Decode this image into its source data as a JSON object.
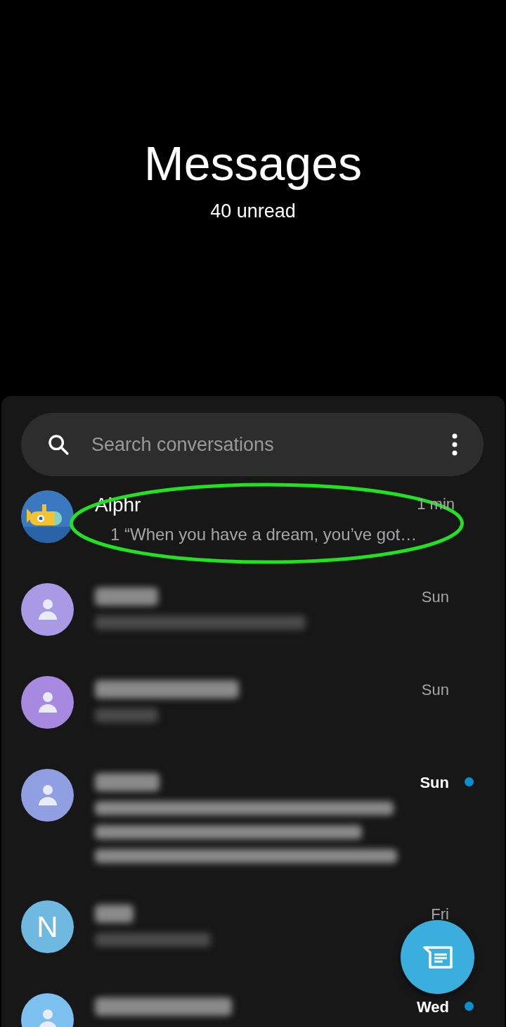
{
  "header": {
    "title": "Messages",
    "subtitle": "40 unread"
  },
  "search": {
    "placeholder": "Search conversations"
  },
  "conversations": [
    {
      "avatar": {
        "kind": "submarine",
        "color": "#3a78c0"
      },
      "name": "Alphr",
      "preview": [
        {
          "kind": "text",
          "text": "1 “When you have a dream, you’ve got…"
        }
      ],
      "time": "1 min",
      "unread": false,
      "highlighted": true
    },
    {
      "avatar": {
        "kind": "person",
        "color": "#a99ae6"
      },
      "name": {
        "kind": "redacted"
      },
      "preview": [
        {
          "kind": "redacted"
        }
      ],
      "time": "Sun",
      "unread": false,
      "highlighted": false
    },
    {
      "avatar": {
        "kind": "person",
        "color": "#a889e0"
      },
      "name": {
        "kind": "redacted"
      },
      "preview": [
        {
          "kind": "redacted"
        }
      ],
      "time": "Sun",
      "unread": false,
      "highlighted": false
    },
    {
      "avatar": {
        "kind": "person",
        "color": "#8f9fe2"
      },
      "name": {
        "kind": "redacted"
      },
      "preview": [
        {
          "kind": "redacted"
        },
        {
          "kind": "redacted"
        },
        {
          "kind": "redacted"
        }
      ],
      "time": "Sun",
      "unread": true,
      "highlighted": false
    },
    {
      "avatar": {
        "kind": "letter",
        "letter": "N",
        "color": "#6fb8e0"
      },
      "name": {
        "kind": "redacted"
      },
      "preview": [
        {
          "kind": "redacted"
        }
      ],
      "time": "Fri",
      "unread": false,
      "highlighted": false
    },
    {
      "avatar": {
        "kind": "person",
        "color": "#7cc0f0"
      },
      "name": {
        "kind": "redacted"
      },
      "time": "Wed",
      "unread": true,
      "highlighted": false
    }
  ]
}
